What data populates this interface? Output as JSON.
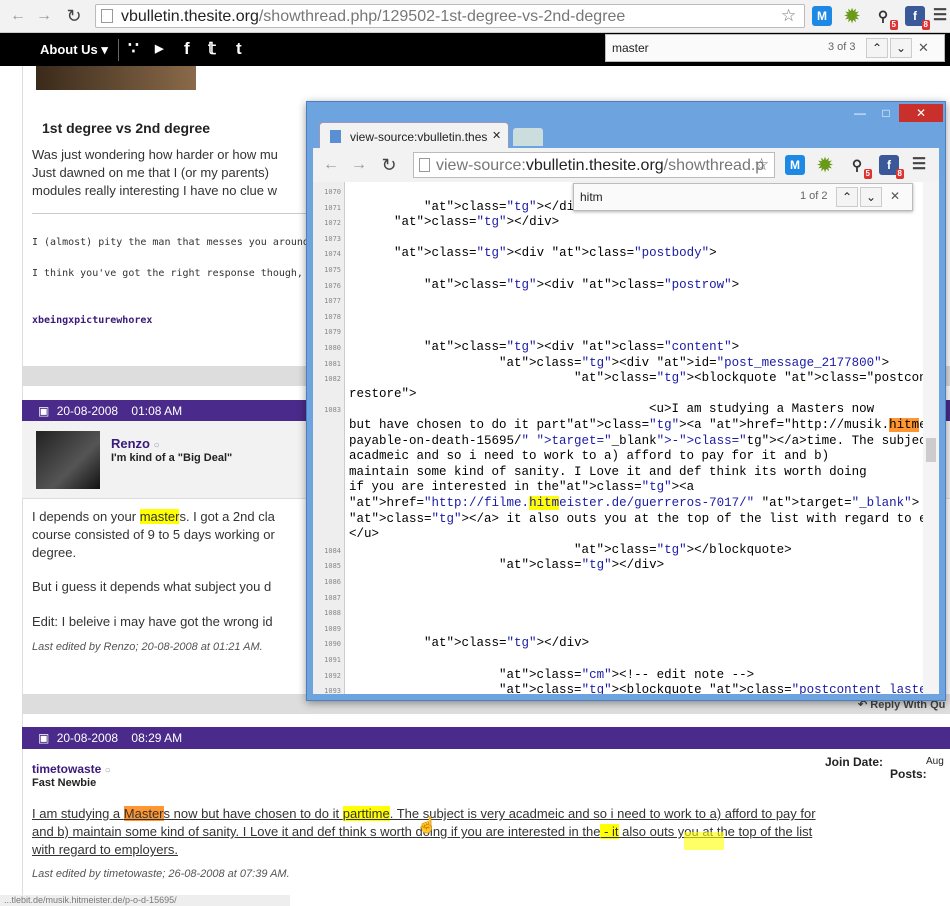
{
  "browser": {
    "url_host": "vbulletin.thesite.org",
    "url_path": "/showthread.php/129502-1st-degree-vs-2nd-degree",
    "find": {
      "query": "master",
      "count": "3 of 3"
    }
  },
  "sitenav": {
    "about": "About Us ▾"
  },
  "thread": {
    "title": "1st degree vs 2nd degree",
    "op_lines": [
      "Was just wondering how harder or how mu",
      "Just dawned on me that I (or my parents)",
      "modules really interesting I have no clue w"
    ],
    "quote1": "I (almost) pity the man that messes you around -",
    "quote2": "I think you've got the right response though, as al",
    "signature": "xbeingxpicturewhorex"
  },
  "post2": {
    "date": "20-08-2008",
    "time": "01:08 AM",
    "username": "Renzo",
    "usertitle": "I'm kind of a \"Big Deal\"",
    "line1_pre": "I depends on your ",
    "line1_hl": "master",
    "line1_post": "s. I got a 2nd cla",
    "line2": "course consisted of 9 to 5 days working or",
    "line3": "degree.",
    "line4": "But i guess it depends what subject you d",
    "line5": "Edit: I beleive i may have got the wrong id",
    "edited": "Last edited by Renzo; 20-08-2008 at 01:21 AM."
  },
  "reply_label": "Reply With Qu",
  "post3": {
    "date": "20-08-2008",
    "time": "08:29 AM",
    "username": "timetowaste",
    "usertitle": "Fast Newbie",
    "join_label": "Join Date:",
    "join_value": "Aug",
    "posts_label": "Posts:",
    "line1_a": "I am studying a ",
    "line1_hl": "Master",
    "line1_b": "s now but have chosen to do it ",
    "line1_c": "part",
    "line1_d": "time",
    "line1_e": ". The subject is very acadmeic and so i need to work to a) afford to pay for",
    "line2_a": "and b) maintain some kind of sanity. I Love it and def think ",
    "line2_b": "s worth doing if you are interested in the",
    "line2_hl": " - it",
    "line2_c": " also outs you at the top of the list",
    "line3": "with regard to employers.",
    "edited": "Last edited by timetowaste; 26-08-2008 at 07:39 AM."
  },
  "status_url": "...tlebit.de/musik.hitmeister.de/p-o-d-15695/",
  "popup": {
    "tab_title": "view-source:vbulletin.thes",
    "url_prefix": "view-source:",
    "url_host": "vbulletin.thesite.org",
    "url_path": "/showthread.p",
    "find": {
      "query": "hitm",
      "count": "1 of 2"
    }
  },
  "source_lines": [
    {
      "n": "1070",
      "code": ""
    },
    {
      "n": "1071",
      "code": "          </div>"
    },
    {
      "n": "1072",
      "code": "      </div>"
    },
    {
      "n": "1073",
      "code": ""
    },
    {
      "n": "1074",
      "code": "      <div class=\"postbody\">"
    },
    {
      "n": "1075",
      "code": ""
    },
    {
      "n": "1076",
      "code": "          <div class=\"postrow\">"
    },
    {
      "n": "1077",
      "code": ""
    },
    {
      "n": "1078",
      "code": ""
    },
    {
      "n": "1079",
      "code": ""
    },
    {
      "n": "1080",
      "code": "          <div class=\"content\">"
    },
    {
      "n": "1081",
      "code": "                    <div id=\"post_message_2177800\">"
    },
    {
      "n": "1082",
      "code": "                              <blockquote class=\"postcontent"
    },
    {
      "n": "",
      "code": "restore\">"
    },
    {
      "n": "1083",
      "code": "                                        <u>I am studying a Masters now"
    },
    {
      "n": "",
      "code": "but have chosen to do it part<a href=\"http://musik.hitmeister.de/p-o-d-"
    },
    {
      "n": "",
      "code": "payable-on-death-15695/\" target=\"_blank\">-</a>time. The subject is very"
    },
    {
      "n": "",
      "code": "acadmeic and so i need to work to a) afford to pay for it and b)"
    },
    {
      "n": "",
      "code": "maintain some kind of sanity. I Love it and def think its worth doing"
    },
    {
      "n": "",
      "code": "if you are interested in the<a"
    },
    {
      "n": "",
      "code": "href=\"http://filme.hitmeister.de/guerreros-7017/\" target=\"_blank\"> -"
    },
    {
      "n": "",
      "code": "</a> it also outs you at the top of the list with regard to employers."
    },
    {
      "n": "",
      "code": "</u>"
    },
    {
      "n": "1084",
      "code": "                              </blockquote>"
    },
    {
      "n": "1085",
      "code": "                    </div>"
    },
    {
      "n": "1086",
      "code": ""
    },
    {
      "n": "1087",
      "code": ""
    },
    {
      "n": "1088",
      "code": ""
    },
    {
      "n": "1089",
      "code": ""
    },
    {
      "n": "1090",
      "code": "          </div>"
    },
    {
      "n": "1091",
      "code": ""
    },
    {
      "n": "1092",
      "code": "                    <!-- edit note -->"
    },
    {
      "n": "1093",
      "code": "                    <blockquote class=\"postcontent lastedited\">"
    }
  ],
  "icons": [
    "back-icon",
    "forward-icon",
    "reload-icon",
    "star-icon",
    "m-extension-icon",
    "gear-extension-icon",
    "key-extension-icon",
    "facebook-extension-icon",
    "menu-icon",
    "rss-icon",
    "youtube-icon",
    "facebook-icon",
    "twitter-icon",
    "tumblr-icon"
  ]
}
